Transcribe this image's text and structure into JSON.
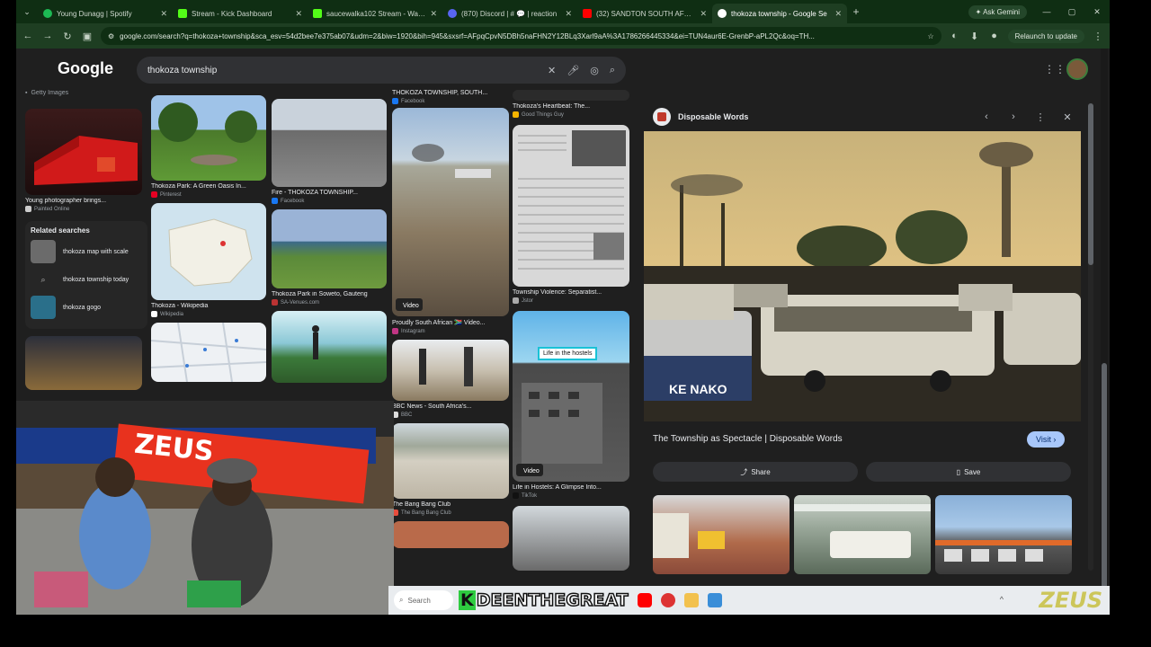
{
  "browser": {
    "tabs": [
      {
        "label": "Young Dunagg | Spotify",
        "color": "#1db954"
      },
      {
        "label": "Stream - Kick Dashboard",
        "color": "#53fc18"
      },
      {
        "label": "saucewalka102 Stream - Watch",
        "color": "#53fc18"
      },
      {
        "label": "(870) Discord | # 💬 | reaction",
        "color": "#5865f2"
      },
      {
        "label": "(32) SANDTON SOUTH AFRICA",
        "color": "#ff0000"
      },
      {
        "label": "thokoza township - Google Se",
        "color": "#ffffff",
        "active": true
      }
    ],
    "ask_gemini": "Ask Gemini",
    "url": "google.com/search?q=thokoza+township&sca_esv=54d2bee7e375ab07&udm=2&biw=1920&bih=945&sxsrf=AFpqCpvN5DBh5naFHN2Y12BLq3Xarl9aA%3A1786266445334&ei=TUN4aur6E-GrenbP-aPL2Qc&oq=TH...",
    "relaunch": "Relaunch to update"
  },
  "google": {
    "logo": "Google",
    "query": "thokoza township"
  },
  "left": {
    "source_top": "Getty Images",
    "card1_caption": "Young photographer brings...",
    "card1_source": "Painted Online",
    "related_heading": "Related searches",
    "related": [
      {
        "label": "thokoza map with scale",
        "icon": "map-thumb"
      },
      {
        "label": "thokoza township today",
        "icon": "search-icon"
      },
      {
        "label": "thokoza gogo",
        "icon": "photo-thumb"
      }
    ]
  },
  "grid": {
    "c1": [
      {
        "caption": "Thokoza Park: A Green Oasis In...",
        "source": "Pinterest"
      },
      {
        "caption": "Thokoza - Wikipedia",
        "source": "Wikipedia"
      }
    ],
    "c2": [
      {
        "caption": "Fire - THOKOZA TOWNSHIP...",
        "source": "Facebook"
      },
      {
        "caption": "Thokoza Park in Soweto, Gauteng",
        "source": "SA-Venues.com"
      }
    ],
    "c3": [
      {
        "caption": "THOKOZA TOWNSHIP, SOUTH...",
        "source": "Facebook"
      },
      {
        "caption": "Proudly South African 🇿🇦 Video...",
        "source": "Instagram",
        "badge": "Video"
      },
      {
        "caption": "BBC News - South Africa's...",
        "source": "BBC"
      },
      {
        "caption": "The Bang Bang Club",
        "source": "The Bang Bang Club"
      }
    ],
    "c4": [
      {
        "caption": "Thokoza's Heartbeat: The...",
        "source": "Good Things Guy"
      },
      {
        "caption": "Township Violence: Separatist...",
        "source": "Jstor"
      },
      {
        "caption": "Life in Hostels: A Glimpse Into...",
        "source": "TikTok",
        "badge": "Video",
        "overlay": "Life in the hostels"
      }
    ]
  },
  "panel": {
    "source_name": "Disposable Words",
    "caption": "The Township as Spectacle | Disposable Words",
    "visit": "Visit",
    "share": "Share",
    "save": "Save",
    "photo_text": "KE NAKO"
  },
  "taskbar": {
    "search": "Search",
    "brand": "DEENTHEGREAT",
    "brand_letter": "K",
    "watermark": "ZEUS"
  },
  "webcam": {
    "banner_text": "ZEUS",
    "brand_color": "#e8321e"
  }
}
